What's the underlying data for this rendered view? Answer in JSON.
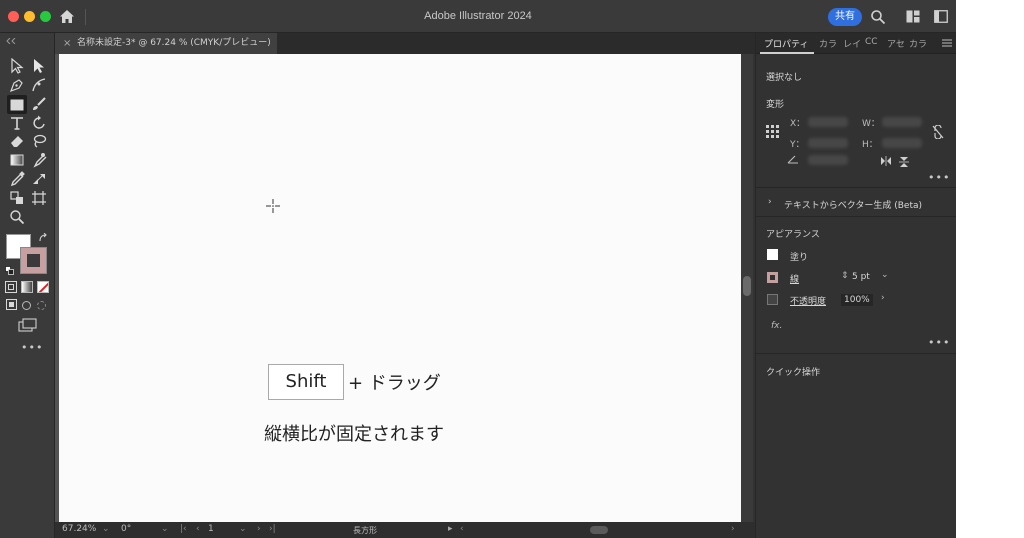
{
  "window": {
    "title": "Adobe Illustrator 2024",
    "share_label": "共有"
  },
  "document_tab": {
    "label": "名称未設定-3* @ 67.24 % (CMYK/プレビュー)"
  },
  "canvas": {
    "shift_key": "Shift",
    "drag_text": "+ ドラッグ",
    "caption": "縦横比が固定されます"
  },
  "status_bar": {
    "zoom": "67.24%",
    "rotation": "0°",
    "artboard_number": "1",
    "current_tool": "長方形"
  },
  "panel": {
    "tabs": [
      "プロパティ",
      "カラ",
      "レイ",
      "CC",
      "アセ",
      "カラ"
    ],
    "selection_state": "選択なし",
    "transform": {
      "title": "変形",
      "x_label": "X：",
      "y_label": "Y：",
      "w_label": "W：",
      "h_label": "H："
    },
    "text_to_vector": "テキストからベクター生成 (Beta)",
    "appearance": {
      "title": "アピアランス",
      "fill_label": "塗り",
      "stroke_label": "線",
      "stroke_weight": "5 pt",
      "opacity_label": "不透明度",
      "opacity_value": "100%",
      "fx_label": "fx."
    },
    "quick_actions": "クイック操作"
  },
  "colors": {
    "app_bg": "#323232",
    "share_button": "#2f6fe0",
    "stroke_swatch": "#c6a0a0",
    "artboard": "#fbfbfb"
  },
  "icons": {
    "toolbar": [
      "selection-tool",
      "direct-selection-tool",
      "pen-tool",
      "curvature-tool",
      "rectangle-tool",
      "paintbrush-tool",
      "type-tool",
      "rotate-tool",
      "eraser-tool",
      "lasso-tool",
      "gradient-tool",
      "eyedropper-tool",
      "blend-tool",
      "shape-builder-tool",
      "artboard-tool",
      "zoom-tool"
    ]
  }
}
